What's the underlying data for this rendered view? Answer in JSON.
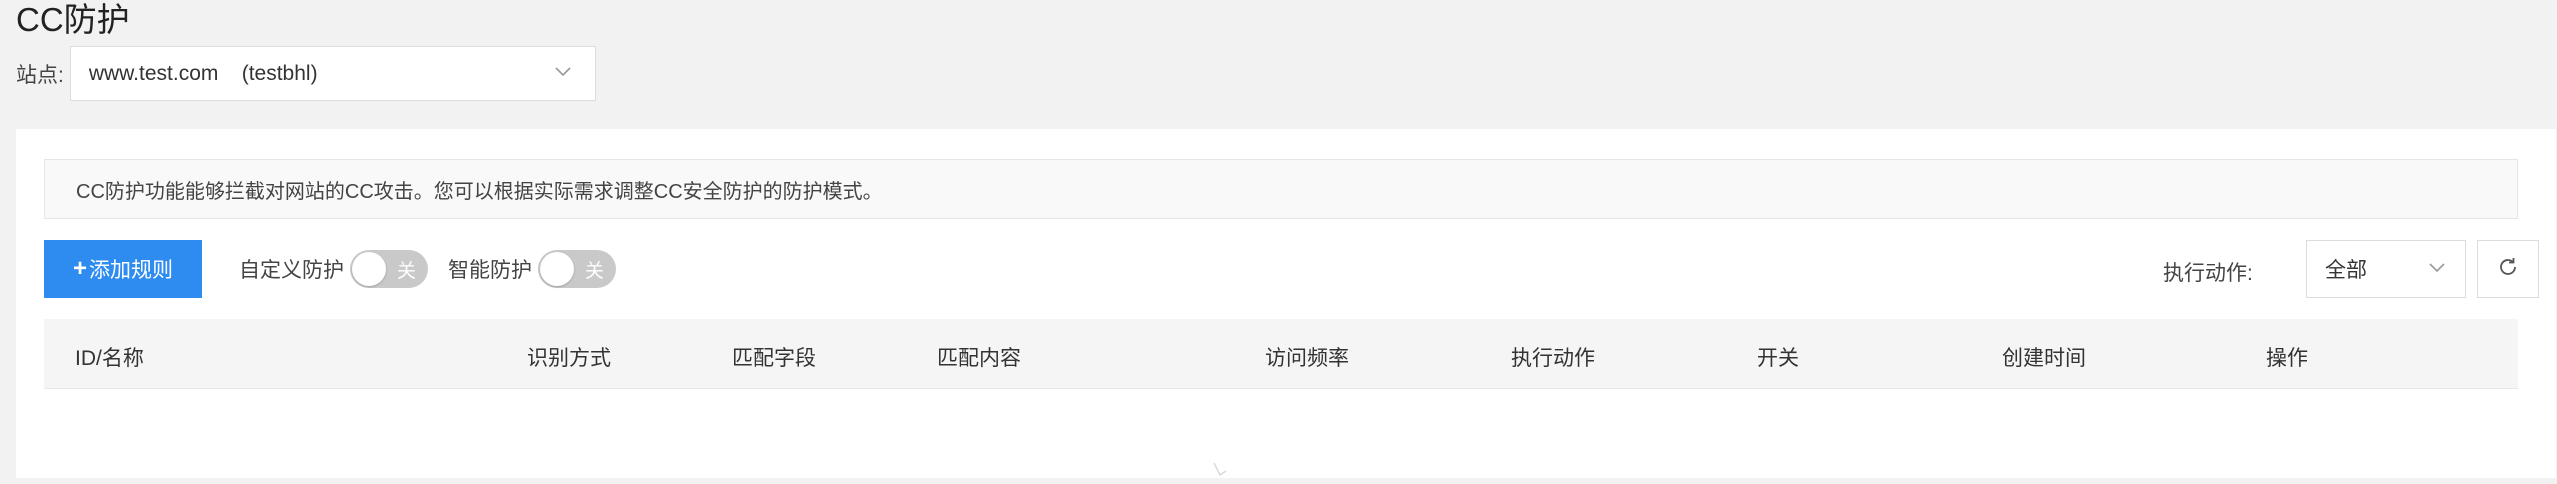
{
  "header": {
    "title": "CC防护"
  },
  "site": {
    "label": "站点:",
    "selected": "www.test.com    (testbhl)"
  },
  "info": {
    "text": "CC防护功能能够拦截对网站的CC攻击。您可以根据实际需求调整CC安全防护的防护模式。"
  },
  "toolbar": {
    "add_label": "添加规则",
    "custom_protection_label": "自定义防护",
    "custom_protection_state": "关",
    "smart_protection_label": "智能防护",
    "smart_protection_state": "关",
    "action_label": "执行动作:",
    "action_selected": "全部"
  },
  "table": {
    "columns": [
      "ID/名称",
      "识别方式",
      "匹配字段",
      "匹配内容",
      "访问频率",
      "执行动作",
      "开关",
      "创建时间",
      "操作"
    ]
  },
  "icons": {
    "add": "plus-icon",
    "site_dropdown": "chevron-down-icon",
    "action_dropdown": "chevron-down-icon",
    "refresh": "refresh-icon"
  },
  "colors": {
    "primary": "#2e8cf0",
    "switch_off": "#c9c9c9"
  }
}
